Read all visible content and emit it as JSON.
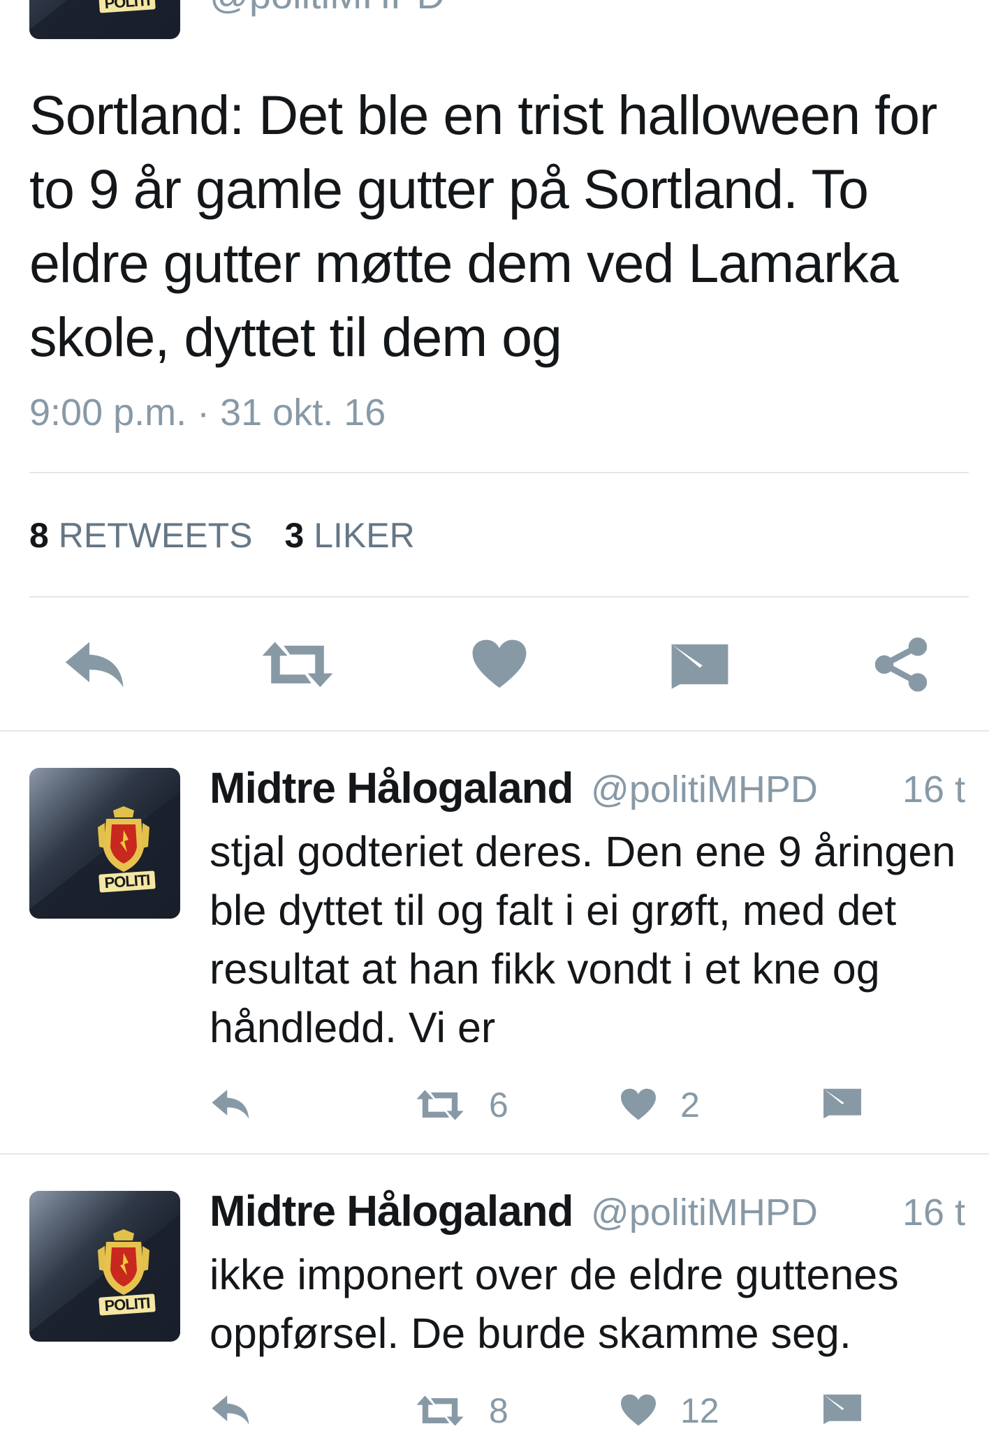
{
  "top_tweet": {
    "handle": "@politiMHPD",
    "text": "Sortland: Det ble en trist halloween for to 9 år gamle gutter på Sortland. To eldre gutter møtte dem ved Lamarka skole, dyttet til dem og",
    "timestamp": "9:00 p.m. · 31 okt. 16",
    "retweets_count": "8",
    "retweets_label": "RETWEETS",
    "likes_count": "3",
    "likes_label": "LIKER",
    "avatar_badge_text": "POLITI"
  },
  "tweets": [
    {
      "name": "Midtre Hålogaland",
      "handle": "@politiMHPD",
      "time": "16 t",
      "text": "stjal godteriet deres. Den ene 9 åringen ble dyttet til og falt i ei grøft, med det resultat at han fikk vondt i et kne og håndledd. Vi er",
      "retweets": "6",
      "likes": "2",
      "avatar_badge_text": "POLITI"
    },
    {
      "name": "Midtre Hålogaland",
      "handle": "@politiMHPD",
      "time": "16 t",
      "text": "ikke imponert over de eldre guttenes oppførsel. De burde skamme seg.",
      "retweets": "8",
      "likes": "12",
      "avatar_badge_text": "POLITI"
    }
  ],
  "icons": {
    "reply": "reply-icon",
    "retweet": "retweet-icon",
    "like": "heart-icon",
    "message": "message-icon",
    "share": "share-icon"
  },
  "colors": {
    "icon_gray": "#8899a6",
    "text": "#14171a",
    "divider": "#e1e8ed"
  }
}
